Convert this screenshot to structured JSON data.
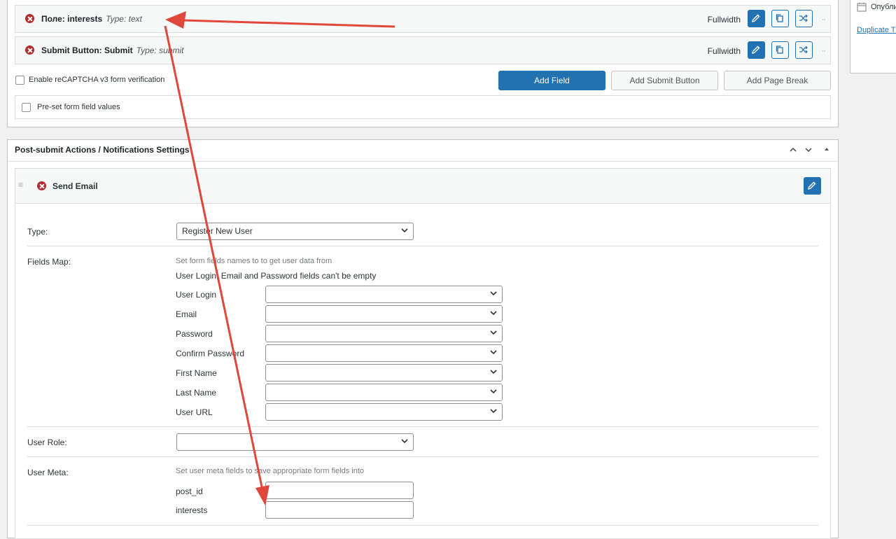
{
  "fields": [
    {
      "label": "Поле:  interests",
      "type": "Type: text",
      "width": "Fullwidth"
    },
    {
      "label": "Submit Button:  Submit",
      "type": "Type: submit",
      "width": "Fullwidth"
    }
  ],
  "recaptcha_label": "Enable reCAPTCHA v3 form verification",
  "buttons": {
    "add_field": "Add Field",
    "add_submit": "Add Submit Button",
    "add_page_break": "Add Page Break"
  },
  "preset_label": "Pre-set form field values",
  "sidebar": {
    "published_label": "Опубли",
    "duplicate_link": "Duplicate Th"
  },
  "post_submit": {
    "title": "Post-submit Actions / Notifications Settings",
    "action_title": "Send Email",
    "type_label": "Type:",
    "type_value": "Register New User",
    "fields_map_label": "Fields Map:",
    "fields_map_hint": "Set form fields names to to get user data from",
    "fields_map_note": "User Login, Email and Password fields can't be empty",
    "map_fields": [
      "User Login",
      "Email",
      "Password",
      "Confirm Password",
      "First Name",
      "Last Name",
      "User URL"
    ],
    "user_role_label": "User Role:",
    "user_meta_label": "User Meta:",
    "user_meta_hint": "Set user meta fields to save appropriate form fields into",
    "meta_fields": [
      "post_id",
      "interests"
    ]
  },
  "colors": {
    "primary": "#2271b1",
    "delete": "#b32d2e",
    "arrow": "#e0473a"
  }
}
